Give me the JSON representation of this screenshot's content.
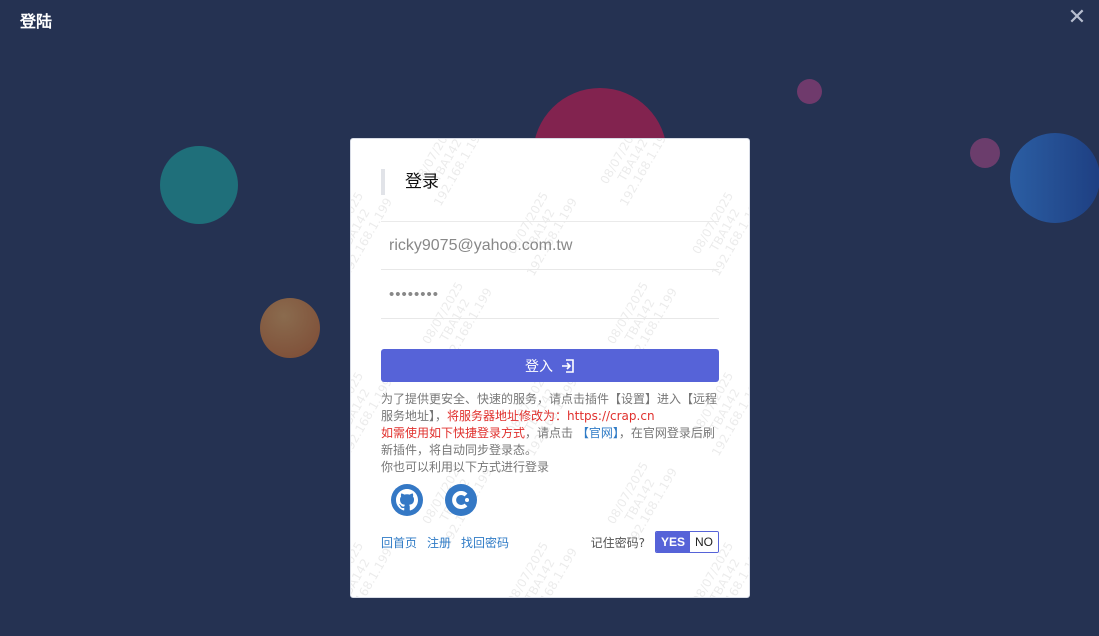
{
  "window": {
    "title": "登陆",
    "close_icon": "close-icon"
  },
  "login": {
    "heading": "登录",
    "email_value": "ricky9075@yahoo.com.tw",
    "password_value": "••••••••",
    "submit_label": "登入",
    "submit_icon": "sign-in-icon",
    "tips": {
      "line1_prefix": "为了提供更安全、快速的服务，请点击插件【设置】进入【远程服务地址】，",
      "line1_red": "将服务器地址修改为：https://crap.cn",
      "line2_red": "如需使用如下快捷登录方式",
      "line2_mid": "，请点击 ",
      "line2_link": "【官网】",
      "line2_suffix": "，在官网登录后刷新插件，将自动同步登录态。",
      "line3": "你也可以利用以下方式进行登录"
    },
    "social": [
      {
        "name": "github-icon"
      },
      {
        "name": "crap-icon"
      }
    ],
    "footer": {
      "home_link": "回首页",
      "register_link": "注册",
      "forgot_link": "找回密码",
      "remember_label": "记住密码?",
      "toggle_yes": "YES",
      "toggle_no": "NO"
    },
    "watermark": [
      "08/07/2025",
      "TBA142",
      "192.168.1.199"
    ]
  },
  "colors": {
    "background": "#253252",
    "accent": "#5663d8",
    "link": "#2f7bc6",
    "warning": "#e0302d"
  }
}
